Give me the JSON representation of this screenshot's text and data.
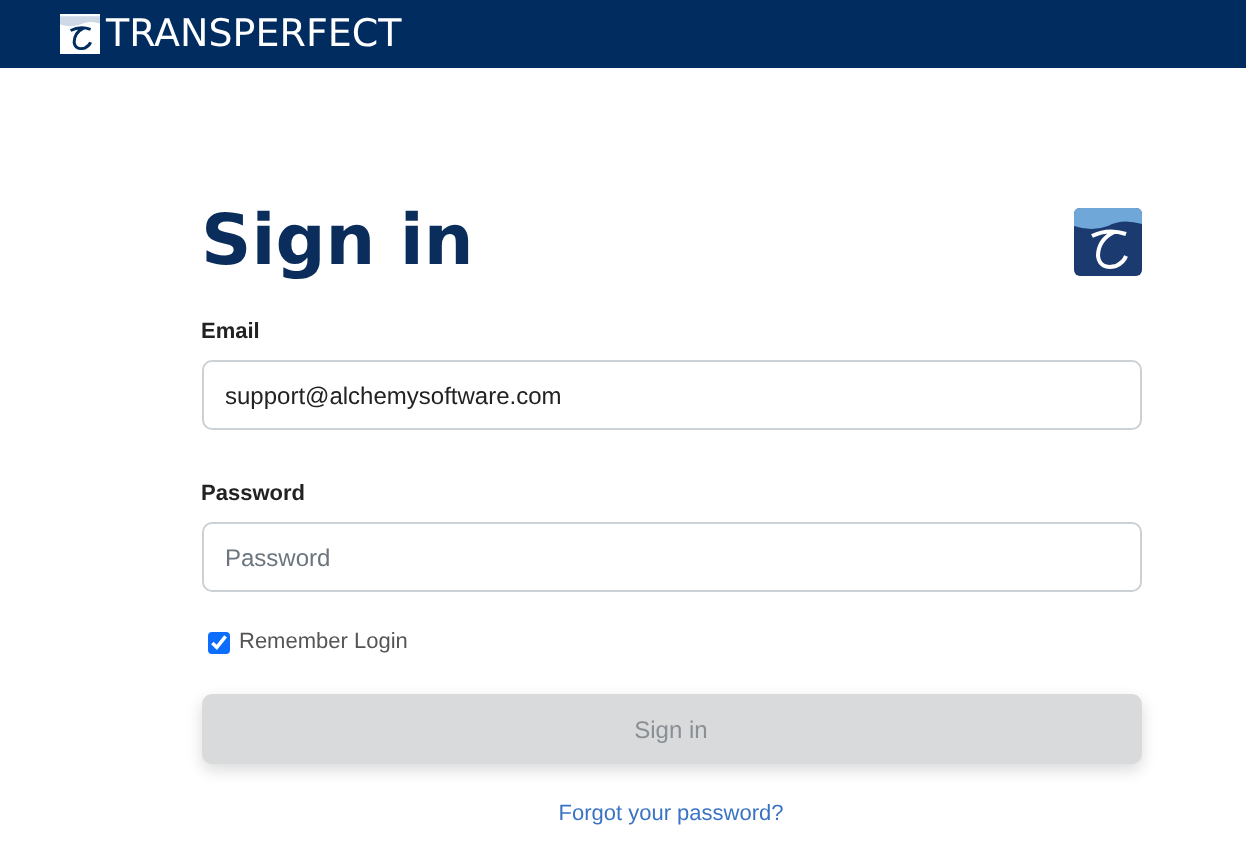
{
  "header": {
    "brand": "TRANSPERFECT"
  },
  "form": {
    "title": "Sign in",
    "email": {
      "label": "Email",
      "value": "support@alchemysoftware.com"
    },
    "password": {
      "label": "Password",
      "placeholder": "Password"
    },
    "remember": {
      "label": "Remember Login",
      "checked": true
    },
    "submit": {
      "label": "Sign in",
      "disabled": true
    },
    "forgot_link": "Forgot your password?"
  }
}
